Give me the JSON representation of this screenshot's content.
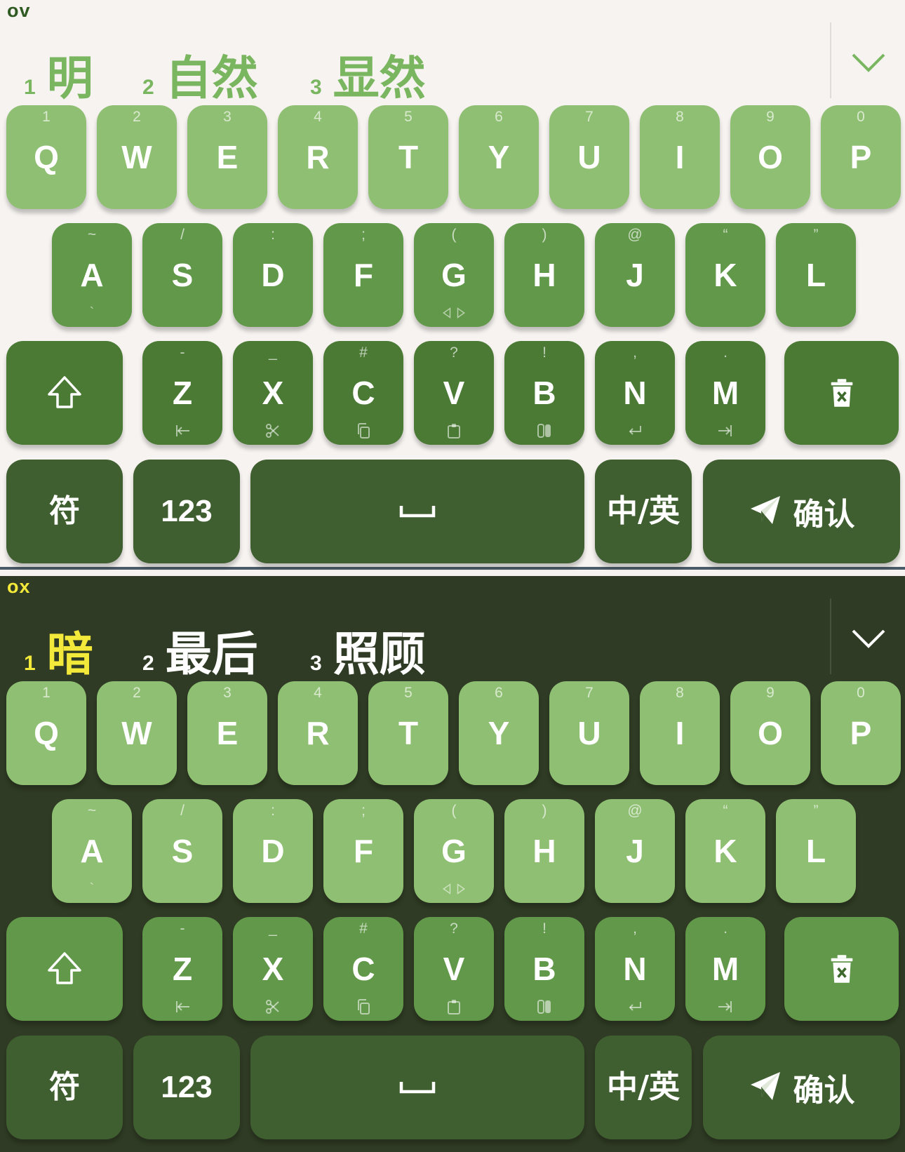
{
  "panels": [
    {
      "theme": "light",
      "composition": "ov",
      "candidates": [
        {
          "index": "1",
          "text": "明"
        },
        {
          "index": "2",
          "text": "自然"
        },
        {
          "index": "3",
          "text": "显然"
        }
      ]
    },
    {
      "theme": "dark",
      "composition": "ox",
      "candidates": [
        {
          "index": "1",
          "text": "暗"
        },
        {
          "index": "2",
          "text": "最后"
        },
        {
          "index": "3",
          "text": "照顾"
        }
      ]
    }
  ],
  "keyboard": {
    "row1": [
      {
        "key": "Q",
        "hint": "1"
      },
      {
        "key": "W",
        "hint": "2"
      },
      {
        "key": "E",
        "hint": "3"
      },
      {
        "key": "R",
        "hint": "4"
      },
      {
        "key": "T",
        "hint": "5"
      },
      {
        "key": "Y",
        "hint": "6"
      },
      {
        "key": "U",
        "hint": "7"
      },
      {
        "key": "I",
        "hint": "8"
      },
      {
        "key": "O",
        "hint": "9"
      },
      {
        "key": "P",
        "hint": "0"
      }
    ],
    "row2": [
      {
        "key": "A",
        "hint": "~",
        "sub": "`"
      },
      {
        "key": "S",
        "hint": "/"
      },
      {
        "key": "D",
        "hint": ":"
      },
      {
        "key": "F",
        "hint": ";"
      },
      {
        "key": "G",
        "hint": "(",
        "sub_icon": "left-right-arrows-icon"
      },
      {
        "key": "H",
        "hint": ")"
      },
      {
        "key": "J",
        "hint": "@"
      },
      {
        "key": "K",
        "hint": "“"
      },
      {
        "key": "L",
        "hint": "”"
      }
    ],
    "row3": [
      {
        "key": "Z",
        "hint": "-",
        "sub_icon": "tab-back-icon"
      },
      {
        "key": "X",
        "hint": "_",
        "sub_icon": "scissors-icon"
      },
      {
        "key": "C",
        "hint": "#",
        "sub_icon": "copy-icon"
      },
      {
        "key": "V",
        "hint": "?",
        "sub_icon": "clipboard-icon"
      },
      {
        "key": "B",
        "hint": "!",
        "sub_icon": "switch-icon"
      },
      {
        "key": "N",
        "hint": ",",
        "sub_icon": "return-icon"
      },
      {
        "key": "M",
        "hint": ".",
        "sub_icon": "tab-forward-icon"
      }
    ],
    "symbols_label": "符",
    "numbers_label": "123",
    "lang_label": "中/英",
    "confirm_label": "确认"
  },
  "colors": {
    "light_bg": "#f6f3f0",
    "dark_bg": "#2f3b24",
    "row1": "#8fbf72",
    "row2": "#62984a",
    "row3": "#4a7a34",
    "row4": "#405f30",
    "light_candidate_green": "#7ab660",
    "dark_highlight_yellow": "#f3e93a"
  }
}
